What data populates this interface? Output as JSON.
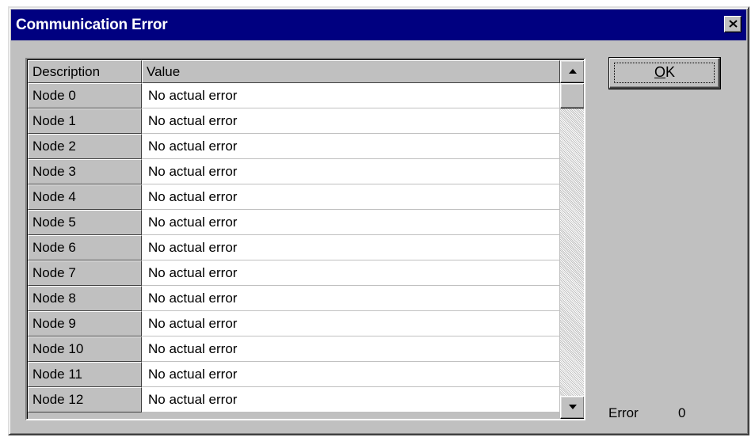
{
  "window": {
    "title": "Communication Error",
    "close_glyph": "close-icon"
  },
  "table": {
    "headers": {
      "description": "Description",
      "value": "Value"
    },
    "rows": [
      {
        "description": "Node 0",
        "value": "No actual error"
      },
      {
        "description": "Node 1",
        "value": "No actual error"
      },
      {
        "description": "Node 2",
        "value": "No actual error"
      },
      {
        "description": "Node 3",
        "value": "No actual error"
      },
      {
        "description": "Node 4",
        "value": "No actual error"
      },
      {
        "description": "Node 5",
        "value": "No actual error"
      },
      {
        "description": "Node 6",
        "value": "No actual error"
      },
      {
        "description": "Node 7",
        "value": "No actual error"
      },
      {
        "description": "Node 8",
        "value": "No actual error"
      },
      {
        "description": "Node 9",
        "value": "No actual error"
      },
      {
        "description": "Node 10",
        "value": "No actual error"
      },
      {
        "description": "Node 11",
        "value": "No actual error"
      },
      {
        "description": "Node 12",
        "value": "No actual error"
      }
    ],
    "scrollbar": {
      "up_icon": "arrow-up-icon",
      "down_icon": "arrow-down-icon",
      "scroll_position": 0
    }
  },
  "buttons": {
    "ok_label": "OK",
    "ok_accelerator": "O",
    "ok_rest": "K"
  },
  "status": {
    "error_label": "Error",
    "error_value": "0"
  },
  "colors": {
    "titlebar": "#000080",
    "dialog_face": "#c0c0c0",
    "cell_background": "#ffffff"
  }
}
